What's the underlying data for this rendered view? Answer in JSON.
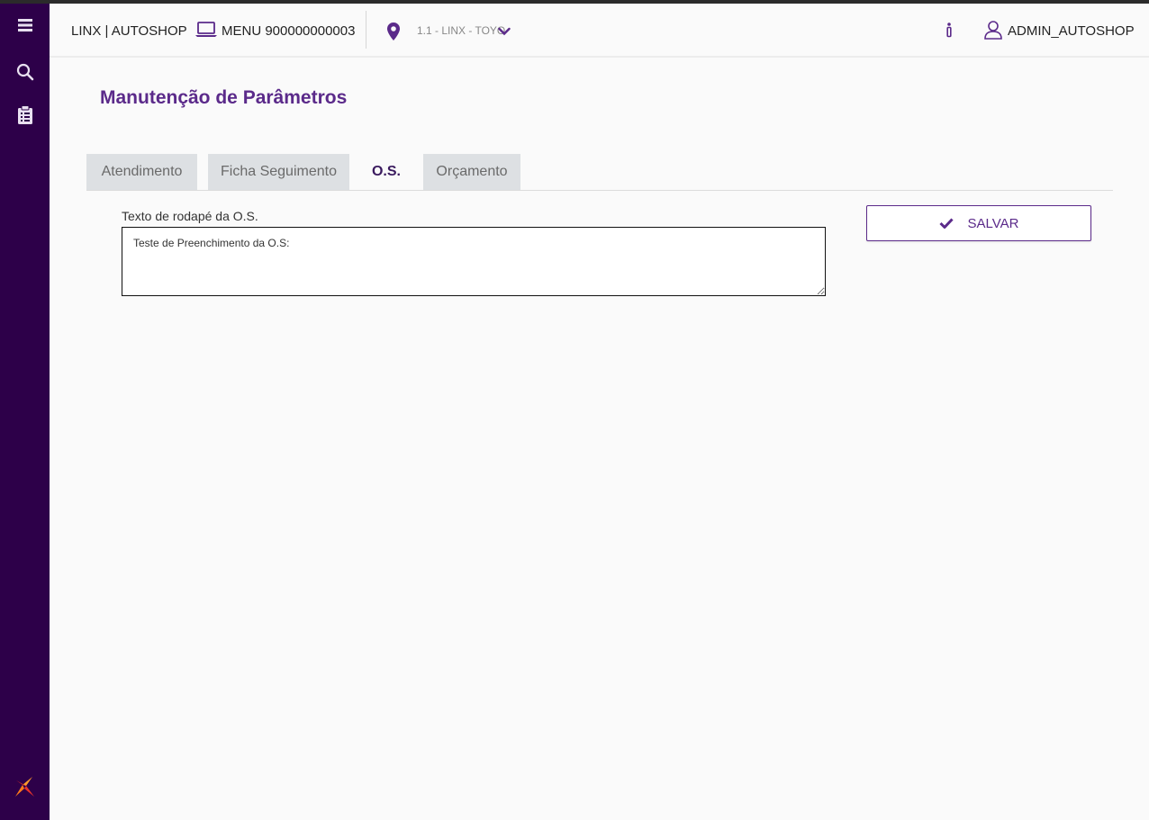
{
  "header": {
    "brand": "LINX | AUTOSHOP",
    "menu_label": "MENU 900000000003",
    "location": "1.1 - LINX - TOYO",
    "user": "ADMIN_AUTOSHOP"
  },
  "sidebar": {
    "items": [
      {
        "icon": "menu-icon"
      },
      {
        "icon": "search-icon"
      },
      {
        "icon": "clipboard-icon"
      }
    ]
  },
  "page": {
    "title": "Manutenção de Parâmetros"
  },
  "tabs": [
    {
      "label": "Atendimento",
      "active": false
    },
    {
      "label": "Ficha Seguimento",
      "active": false
    },
    {
      "label": "O.S.",
      "active": true
    },
    {
      "label": "Orçamento",
      "active": false
    }
  ],
  "form": {
    "footer_label": "Texto de rodapé da O.S.",
    "footer_value": "Teste de Preenchimento da O.S:"
  },
  "actions": {
    "save_label": "SALVAR"
  },
  "colors": {
    "sidebar": "#2d0049",
    "accent": "#5b2a8a"
  }
}
